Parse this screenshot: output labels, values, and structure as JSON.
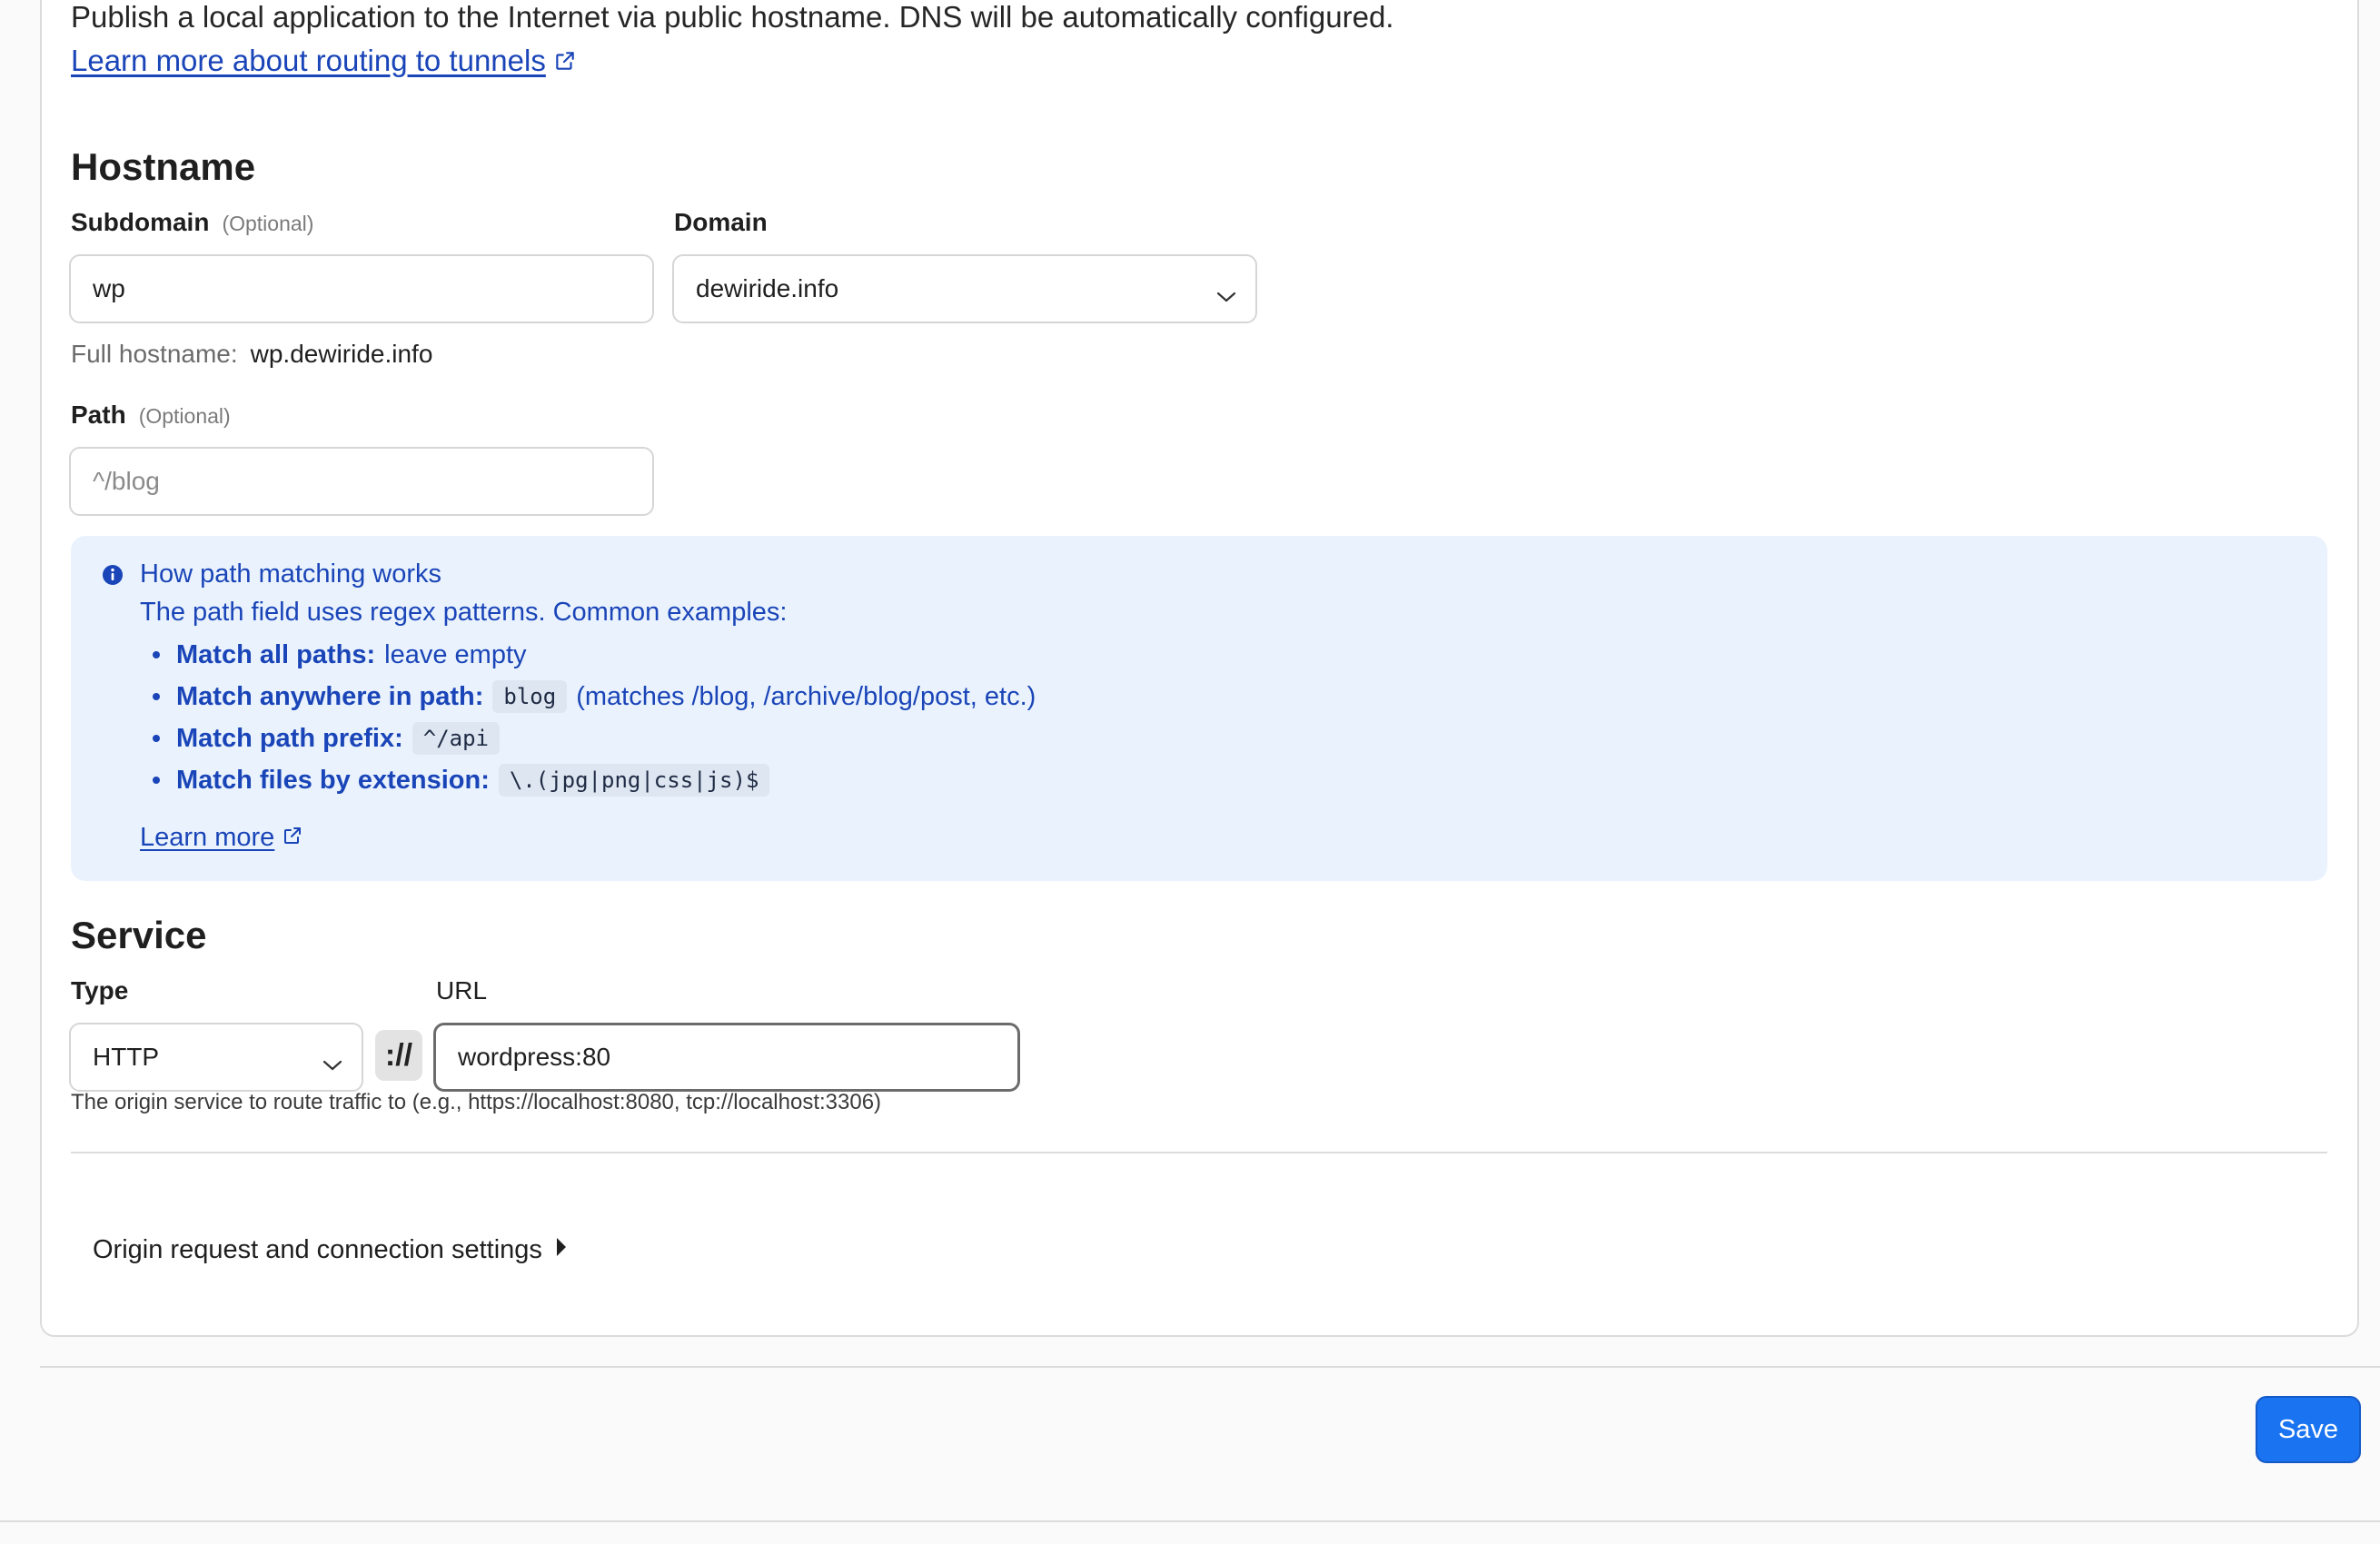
{
  "intro": {
    "text": "Publish a local application to the Internet via public hostname. DNS will be automatically configured.",
    "learn_more": "Learn more about routing to tunnels"
  },
  "hostname": {
    "heading": "Hostname",
    "subdomain_label": "Subdomain",
    "subdomain_optional": "(Optional)",
    "subdomain_value": "wp",
    "domain_label": "Domain",
    "domain_value": "dewiride.info",
    "full_hostname_label": "Full hostname:",
    "full_hostname_value": "wp.dewiride.info",
    "path_label": "Path",
    "path_optional": "(Optional)",
    "path_placeholder": "^/blog"
  },
  "path_info": {
    "title": "How path matching works",
    "description": "The path field uses regex patterns. Common examples:",
    "examples": [
      {
        "label": "Match all paths:",
        "text": "leave empty",
        "code": ""
      },
      {
        "label": "Match anywhere in path:",
        "code": "blog",
        "text": "(matches /blog, /archive/blog/post, etc.)"
      },
      {
        "label": "Match path prefix:",
        "code": "^/api",
        "text": ""
      },
      {
        "label": "Match files by extension:",
        "code": "\\.(jpg|png|css|js)$",
        "text": ""
      }
    ],
    "learn_more": "Learn more"
  },
  "service": {
    "heading": "Service",
    "type_label": "Type",
    "type_value": "HTTP",
    "separator": "://",
    "url_label": "URL",
    "url_value": "wordpress:80",
    "help_text": "The origin service to route traffic to (e.g., https://localhost:8080, tcp://localhost:3306)"
  },
  "origin_settings": {
    "label": "Origin request and connection settings"
  },
  "footer": {
    "save_label": "Save"
  },
  "colors": {
    "accent": "#1a73f0",
    "link": "#1a45b8",
    "info_bg": "#eaf3fd"
  }
}
